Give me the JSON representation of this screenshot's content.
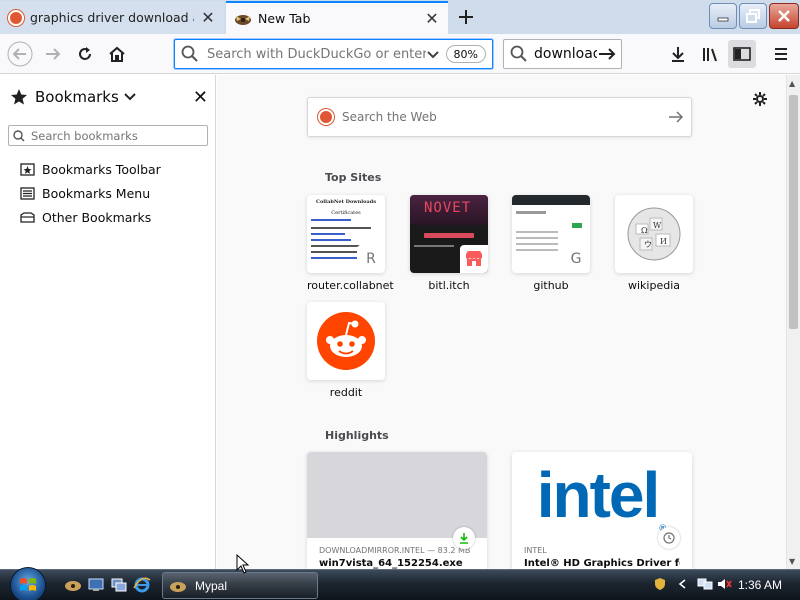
{
  "tabs": [
    {
      "title": "graphics driver download at Du",
      "favicon": "duckduckgo-icon",
      "active": false
    },
    {
      "title": "New Tab",
      "favicon": "firefox-icon",
      "active": true
    }
  ],
  "toolbar": {
    "url_placeholder": "Search with DuckDuckGo or enter address",
    "zoom": "80%",
    "search_value": "download"
  },
  "sidebar": {
    "title": "Bookmarks",
    "search_placeholder": "Search bookmarks",
    "items": [
      {
        "label": "Bookmarks Toolbar",
        "icon": "toolbar-icon"
      },
      {
        "label": "Bookmarks Menu",
        "icon": "menu-icon"
      },
      {
        "label": "Other Bookmarks",
        "icon": "folder-icon"
      }
    ]
  },
  "newtab": {
    "search_placeholder": "Search the Web",
    "top_sites_title": "Top Sites",
    "top_sites": [
      {
        "label": "router.collabnet",
        "letter": "R"
      },
      {
        "label": "bitl.itch",
        "letter": ""
      },
      {
        "label": "github",
        "letter": "G"
      },
      {
        "label": "wikipedia",
        "letter": ""
      },
      {
        "label": "reddit",
        "letter": ""
      }
    ],
    "thumb_router": {
      "heading": "CollabNet Downloads",
      "sub": "Certificates"
    },
    "thumb_itch_banner": "NOVET",
    "highlights_title": "Highlights",
    "highlights": [
      {
        "source": "DOWNLOADMIRROR.INTEL — 83.2 MB",
        "title": "win7vista_64_152254.exe",
        "badge": "download-icon"
      },
      {
        "source": "INTEL",
        "title": "Intel® HD Graphics Driver for ...",
        "badge": "clock-icon",
        "logo": "intel"
      }
    ]
  },
  "taskbar": {
    "task_label": "Mypal",
    "clock": "1:36 AM"
  },
  "colors": {
    "accent": "#0a84ff",
    "ddg": "#de5833",
    "reddit": "#ff4500",
    "intel": "#0068b5",
    "tabstrip": "#cfdcec"
  }
}
